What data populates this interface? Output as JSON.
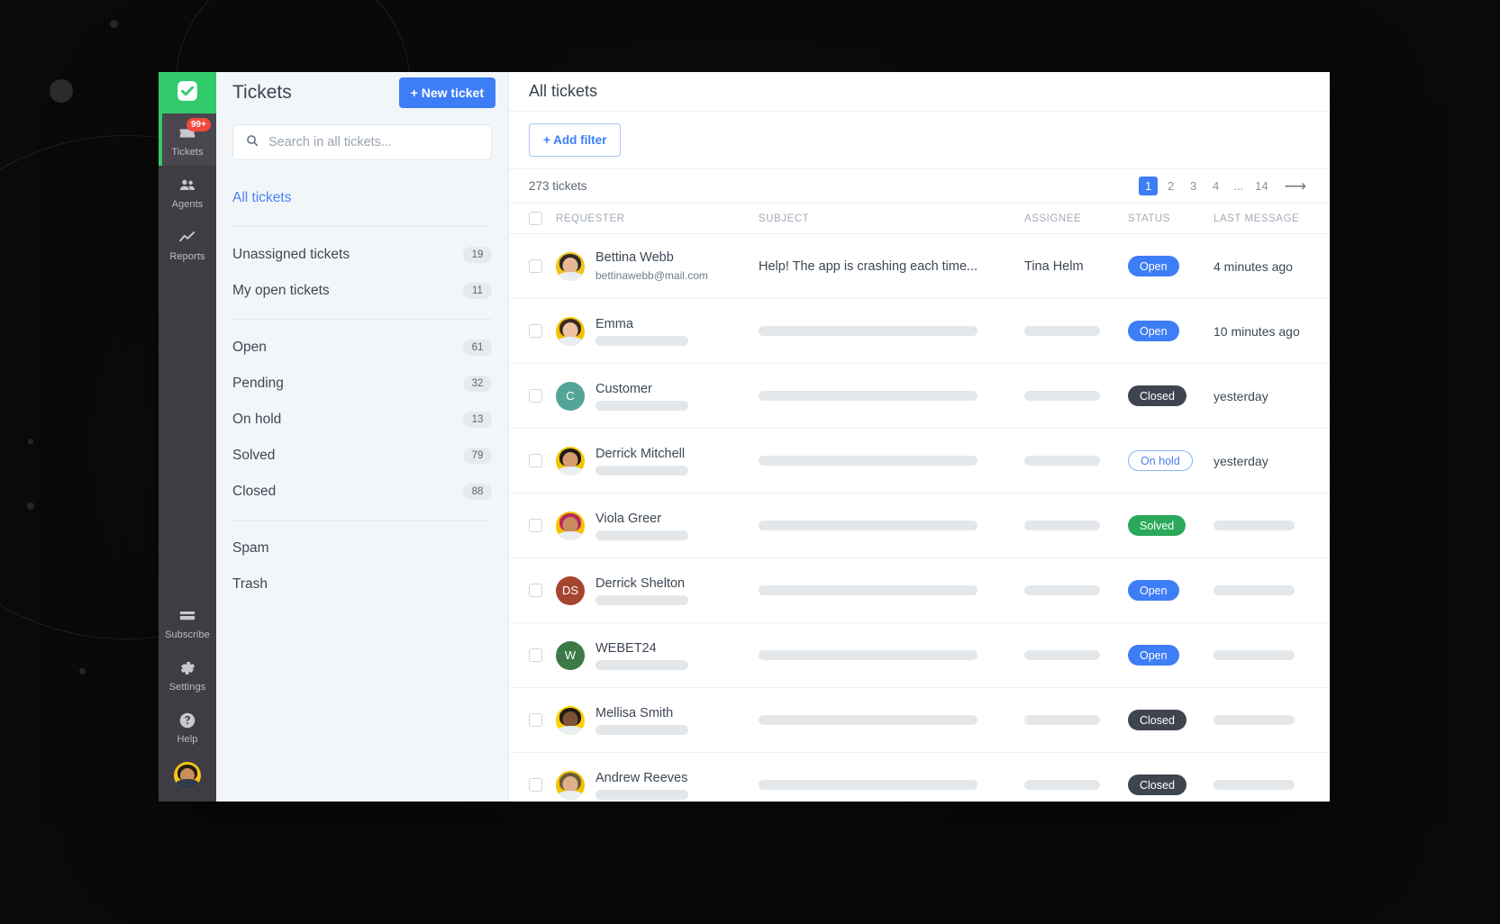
{
  "app": {
    "logo_icon": "checkbox-check-icon",
    "rail": [
      {
        "icon": "ticket-icon",
        "label": "Tickets",
        "badge": "99+",
        "active": true
      },
      {
        "icon": "people-icon",
        "label": "Agents",
        "badge": "",
        "active": false
      },
      {
        "icon": "chart-line-icon",
        "label": "Reports",
        "badge": "",
        "active": false
      }
    ],
    "rail_bottom": [
      {
        "icon": "credit-card-icon",
        "label": "Subscribe"
      },
      {
        "icon": "gear-icon",
        "label": "Settings"
      },
      {
        "icon": "question-circle-icon",
        "label": "Help"
      }
    ],
    "user_avatar": "user-avatar"
  },
  "panel": {
    "title": "Tickets",
    "new_ticket_label": "+ New ticket",
    "search": {
      "placeholder": "Search in all tickets...",
      "value": "",
      "icon": "search-icon"
    },
    "primary_link": "All tickets",
    "groups": [
      [
        {
          "label": "Unassigned tickets",
          "count": "19"
        },
        {
          "label": "My open tickets",
          "count": "11"
        }
      ],
      [
        {
          "label": "Open",
          "count": "61"
        },
        {
          "label": "Pending",
          "count": "32"
        },
        {
          "label": "On hold",
          "count": "13"
        },
        {
          "label": "Solved",
          "count": "79"
        },
        {
          "label": "Closed",
          "count": "88"
        }
      ],
      [
        {
          "label": "Spam",
          "count": ""
        },
        {
          "label": "Trash",
          "count": ""
        }
      ]
    ]
  },
  "main": {
    "title": "All tickets",
    "add_filter_label": "+ Add filter",
    "ticket_count": "273 tickets",
    "pagination": {
      "pages": [
        "1",
        "2",
        "3",
        "4",
        "...",
        "14"
      ],
      "current": "1",
      "next_icon": "arrow-right-icon",
      "next_glyph": "⟶"
    },
    "columns": [
      "REQUESTER",
      "SUBJECT",
      "ASSIGNEE",
      "STATUS",
      "LAST MESSAGE"
    ],
    "rows": [
      {
        "name": "Bettina Webb",
        "email": "bettinawebb@mail.com",
        "subject": "Help! The app is crashing each time...",
        "assignee": "Tina Helm",
        "status": "Open",
        "status_kind": "open",
        "last": "4 minutes ago",
        "avatar_kind": "photo",
        "avatar_bg": "#f0c419",
        "avatar_hair": "#2f2a26",
        "avatar_skin": "#e8b894"
      },
      {
        "name": "Emma",
        "email": "",
        "subject": "",
        "assignee": "",
        "status": "Open",
        "status_kind": "open",
        "last": "10 minutes ago",
        "avatar_kind": "photo",
        "avatar_bg": "#f2c200",
        "avatar_hair": "#3b2a20",
        "avatar_skin": "#f0c3a0"
      },
      {
        "name": "Customer",
        "email": "",
        "subject": "",
        "assignee": "",
        "status": "Closed",
        "status_kind": "closed",
        "last": "yesterday",
        "avatar_kind": "initial",
        "avatar_bg": "#53a597",
        "initial": "C"
      },
      {
        "name": "Derrick Mitchell",
        "email": "",
        "subject": "",
        "assignee": "",
        "status": "On hold",
        "status_kind": "onhold",
        "last": "yesterday",
        "avatar_kind": "photo",
        "avatar_bg": "#f5c400",
        "avatar_hair": "#1d1a17",
        "avatar_skin": "#d69b6e"
      },
      {
        "name": "Viola Greer",
        "email": "",
        "subject": "",
        "assignee": "",
        "status": "Solved",
        "status_kind": "solved",
        "last": "",
        "avatar_kind": "photo",
        "avatar_bg": "#f5c400",
        "avatar_hair": "#b72a5c",
        "avatar_skin": "#c98a62"
      },
      {
        "name": "Derrick Shelton",
        "email": "",
        "subject": "",
        "assignee": "",
        "status": "Open",
        "status_kind": "open",
        "last": "",
        "avatar_kind": "initial",
        "avatar_bg": "#a6452f",
        "initial": "DS"
      },
      {
        "name": "WEBET24",
        "email": "",
        "subject": "",
        "assignee": "",
        "status": "Open",
        "status_kind": "open",
        "last": "",
        "avatar_kind": "initial",
        "avatar_bg": "#3b7a46",
        "initial": "W"
      },
      {
        "name": "Mellisa Smith",
        "email": "",
        "subject": "",
        "assignee": "",
        "status": "Closed",
        "status_kind": "closed",
        "last": "",
        "avatar_kind": "photo",
        "avatar_bg": "#ffd000",
        "avatar_hair": "#211b16",
        "avatar_skin": "#7d5237"
      },
      {
        "name": "Andrew Reeves",
        "email": "",
        "subject": "",
        "assignee": "",
        "status": "Closed",
        "status_kind": "closed",
        "last": "",
        "avatar_kind": "photo",
        "avatar_bg": "#f2c200",
        "avatar_hair": "#6b5a3e",
        "avatar_skin": "#e0b08a"
      }
    ]
  },
  "colors": {
    "brand_green": "#31cb6b",
    "accent_blue": "#3d7df6",
    "status_open": "#3d7df6",
    "status_closed": "#3f4550",
    "status_solved": "#2aa95b",
    "status_onhold_border": "#8fb2f5",
    "badge_red": "#f4483b",
    "rail_bg": "#403c44",
    "panel_bg": "#f2f6f9"
  }
}
